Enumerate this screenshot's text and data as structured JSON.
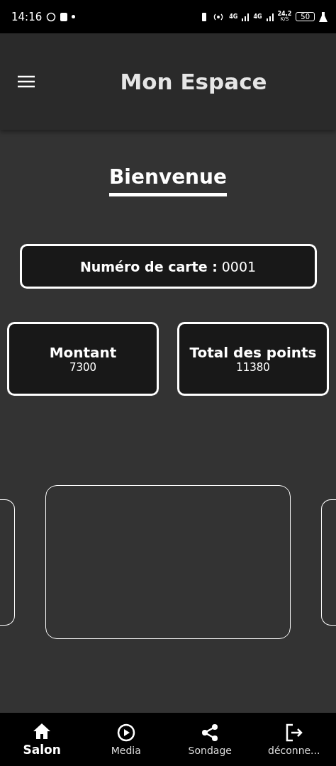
{
  "status_bar": {
    "time": "14:16",
    "network_1": "4G",
    "network_2": "4G",
    "speed": "24,2",
    "speed_unit": "K/S",
    "battery": "50"
  },
  "app_bar": {
    "title": "Mon Espace"
  },
  "welcome": "Bienvenue",
  "card_number": {
    "label": "Numéro de carte :",
    "value": "0001"
  },
  "stats": [
    {
      "label": "Montant",
      "value": "7300"
    },
    {
      "label": "Total des points",
      "value": "11380"
    }
  ],
  "nav": [
    {
      "label": "Salon",
      "kind": "home",
      "selected": true
    },
    {
      "label": "Media",
      "kind": "play",
      "selected": false
    },
    {
      "label": "Sondage",
      "kind": "share",
      "selected": false
    },
    {
      "label": "déconne...",
      "kind": "logout",
      "selected": false
    }
  ]
}
